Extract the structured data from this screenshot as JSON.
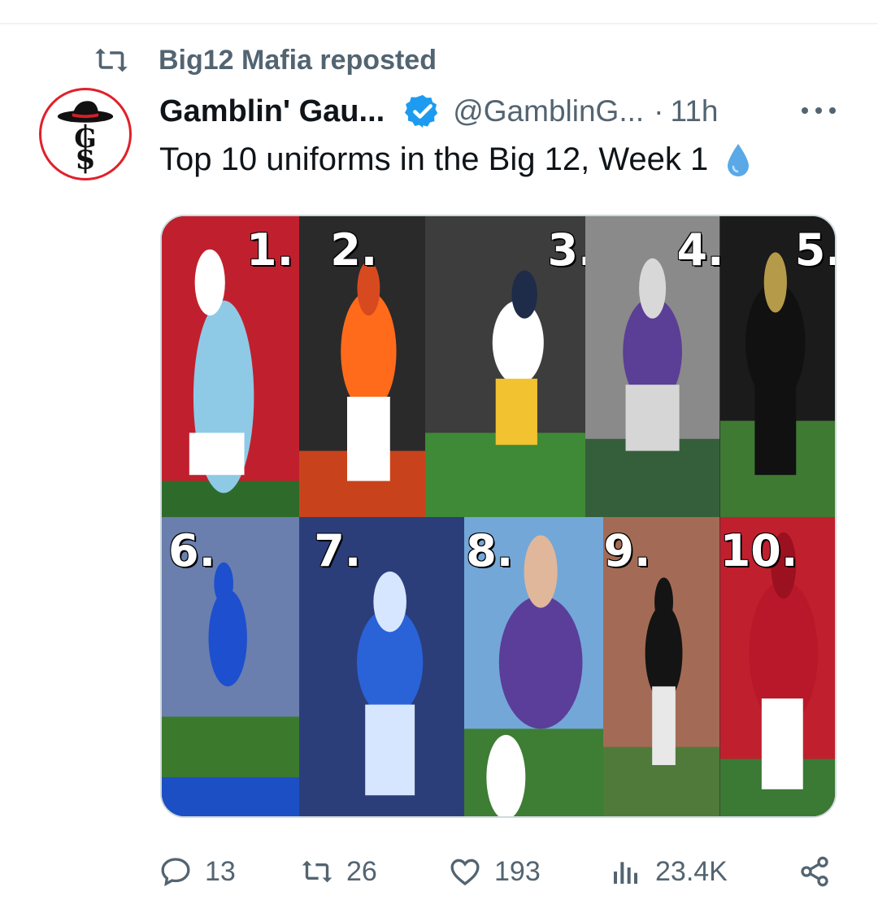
{
  "repost": {
    "label": "Big12 Mafia reposted",
    "icon": "repost-icon"
  },
  "author": {
    "display_name": "Gamblin' Gau...",
    "handle": "@GamblinG...",
    "separator": "·",
    "time": "11h",
    "verified": true,
    "avatar_letters": "GS"
  },
  "tweet": {
    "text": "Top 10 uniforms in the Big 12, Week 1",
    "emoji": "droplet-icon"
  },
  "media": {
    "tiles": [
      {
        "rank": "1.",
        "colors": [
          "#c0202e",
          "#8ecae6",
          "#ffffff"
        ]
      },
      {
        "rank": "2.",
        "colors": [
          "#2a2a2a",
          "#ff6b1a",
          "#ffffff"
        ]
      },
      {
        "rank": "3.",
        "colors": [
          "#3d3d3d",
          "#ffffff",
          "#f2c230"
        ]
      },
      {
        "rank": "4.",
        "colors": [
          "#8a8a8a",
          "#5b3e96",
          "#d6d6d6"
        ]
      },
      {
        "rank": "5.",
        "colors": [
          "#1b1b1b",
          "#111111",
          "#3f7a32"
        ]
      },
      {
        "rank": "6.",
        "colors": [
          "#6a7fae",
          "#1d4fcf",
          "#3b7a2c"
        ]
      },
      {
        "rank": "7.",
        "colors": [
          "#2b3e7a",
          "#2a62d8",
          "#d7e6ff"
        ]
      },
      {
        "rank": "8.",
        "colors": [
          "#73a7d8",
          "#5a3e9a",
          "#ffffff"
        ]
      },
      {
        "rank": "9.",
        "colors": [
          "#a36b55",
          "#141414",
          "#4f7a3a"
        ]
      },
      {
        "rank": "10.",
        "colors": [
          "#c0202e",
          "#b8182a",
          "#ffffff"
        ]
      }
    ]
  },
  "actions": {
    "replies": "13",
    "reposts": "26",
    "likes": "193",
    "views": "23.4K"
  },
  "colors": {
    "text_primary": "#0f1419",
    "text_secondary": "#536471",
    "verified_blue": "#1d9bf0"
  }
}
